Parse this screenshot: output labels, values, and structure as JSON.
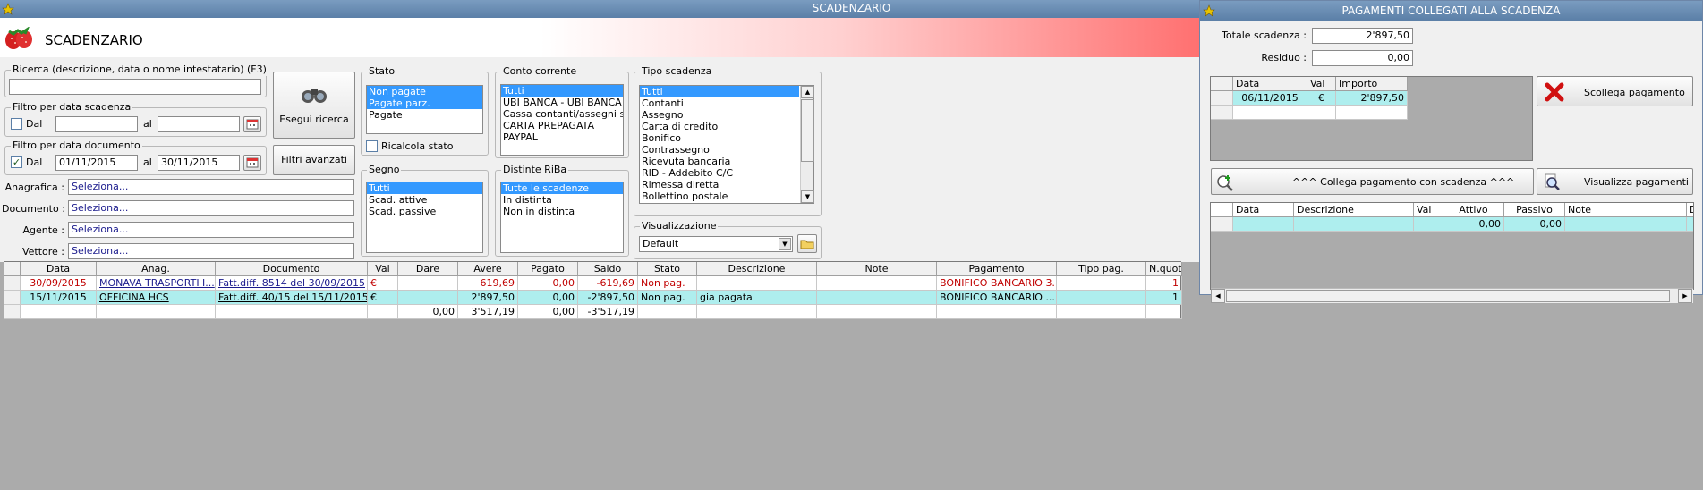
{
  "main_window": {
    "title": "SCADENZARIO",
    "header_title": "SCADENZARIO",
    "search": {
      "label": "Ricerca (descrizione, data o nome intestatario) (F3)",
      "value": ""
    },
    "filter_due": {
      "label": "Filtro per data scadenza",
      "dal_label": "Dal",
      "al_label": "al",
      "from": "",
      "to": "",
      "checked": false
    },
    "filter_doc": {
      "label": "Filtro per data documento",
      "dal_label": "Dal",
      "al_label": "al",
      "from": "01/11/2015",
      "to": "30/11/2015",
      "checked": true
    },
    "search_button": "Esegui ricerca",
    "advanced_button": "Filtri avanzati",
    "fields": [
      {
        "label": "Anagrafica :",
        "value": "Seleziona..."
      },
      {
        "label": "Documento :",
        "value": "Seleziona..."
      },
      {
        "label": "Agente :",
        "value": "Seleziona..."
      },
      {
        "label": "Vettore :",
        "value": "Seleziona..."
      }
    ],
    "stato": {
      "label": "Stato",
      "items": [
        "Non pagate",
        "Pagate parz.",
        "Pagate"
      ],
      "selected": [
        0,
        1
      ],
      "recalc_label": "Ricalcola stato"
    },
    "segno": {
      "label": "Segno",
      "items": [
        "Tutti",
        "Scad. attive",
        "Scad. passive"
      ],
      "selected": [
        0
      ]
    },
    "conto": {
      "label": "Conto corrente",
      "items": [
        "Tutti",
        "UBI BANCA - UBI BANCA",
        "Cassa contanti/assegni sede",
        "CARTA PREPAGATA",
        "PAYPAL"
      ],
      "selected": [
        0
      ]
    },
    "distinte": {
      "label": "Distinte RiBa",
      "items": [
        "Tutte le scadenze",
        "In distinta",
        "Non in distinta"
      ],
      "selected": [
        0
      ]
    },
    "tipo": {
      "label": "Tipo scadenza",
      "items": [
        "Tutti",
        "Contanti",
        "Assegno",
        "Carta di credito",
        "Bonifico",
        "Contrassegno",
        "Ricevuta bancaria",
        "RID - Addebito C/C",
        "Rimessa diretta",
        "Bollettino postale"
      ],
      "selected": [
        0
      ]
    },
    "visual": {
      "label": "Visualizzazione",
      "value": "Default"
    },
    "table": {
      "headers": [
        "",
        "Data",
        "Anag.",
        "Documento",
        "Val",
        "Dare",
        "Avere",
        "Pagato",
        "Saldo",
        "Stato",
        "Descrizione",
        "Note",
        "Pagamento",
        "Tipo pag.",
        "N.quota"
      ],
      "rows": [
        {
          "cells": [
            "",
            "30/09/2015",
            "MONAVA TRASPORTI I...",
            "Fatt.diff. 8514 del 30/09/2015",
            "€",
            "",
            "619,69",
            "0,00",
            "-619,69",
            "Non pag.",
            "",
            "",
            "BONIFICO BANCARIO 3...",
            "",
            "1"
          ],
          "style": "red"
        },
        {
          "cells": [
            "",
            "15/11/2015",
            "OFFICINA HCS",
            "Fatt.diff. 40/15 del 15/11/2015",
            "€",
            "",
            "2'897,50",
            "0,00",
            "-2'897,50",
            "Non pag.",
            "gia pagata",
            "",
            "BONIFICO BANCARIO ...",
            "",
            "1"
          ],
          "style": "cyan"
        },
        {
          "cells": [
            "",
            "",
            "",
            "",
            "",
            "0,00",
            "3'517,19",
            "0,00",
            "-3'517,19",
            "",
            "",
            "",
            "",
            "",
            ""
          ],
          "style": "total"
        }
      ]
    }
  },
  "payments_window": {
    "title": "PAGAMENTI COLLEGATI ALLA SCADENZA",
    "totale_label": "Totale scadenza :",
    "totale_value": "2'897,50",
    "residuo_label": "Residuo :",
    "residuo_value": "0,00",
    "top_grid": {
      "headers": [
        "",
        "Data",
        "Val",
        "Importo"
      ],
      "rows": [
        [
          "",
          "06/11/2015",
          "€",
          "2'897,50"
        ]
      ]
    },
    "scollega_button": "Scollega pagamento",
    "collega_button": "^^^ Collega pagamento con scadenza ^^^",
    "visualizza_button": "Visualizza pagamenti",
    "bottom_grid": {
      "headers": [
        "",
        "Data",
        "Descrizione",
        "Val",
        "Attivo",
        "Passivo",
        "Note",
        "Da"
      ],
      "rows": [
        [
          "",
          "",
          "",
          "",
          "0,00",
          "0,00",
          "",
          ""
        ]
      ]
    }
  }
}
